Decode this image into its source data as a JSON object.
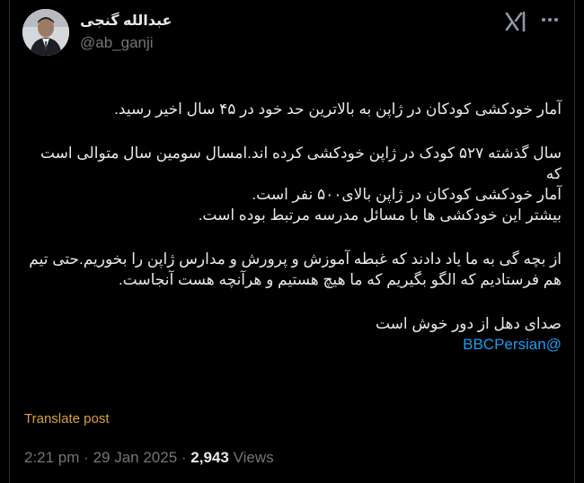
{
  "author": {
    "name": "عبدالله گنجی",
    "handle": "@ab_ganji"
  },
  "icons": {
    "avatar": "avatar",
    "grok": "grok-icon",
    "more": "more-icon"
  },
  "post": {
    "p1": "آمار خودکشی کودکان در ژاپن به بالاترین حد خود در ۴۵ سال اخیر رسید.",
    "p2a": "سال گذشته ۵۲۷ کودک در ژاپن خودکشی کرده اند.امسال سومین سال متوالی است که",
    "p2b": "آمار خودکشی کودکان در ژاپن بالای۵۰۰ نفر است.",
    "p2c": "بیشتر این خودکشی ها با مسائل مدرسه مرتبط بوده است.",
    "p3a": "از بچه گی به ما یاد دادند که غبطه آموزش و پرورش و مدارس ژاپن را بخوریم.حتی تیم",
    "p3b": "هم فرستادیم که الگو بگیریم که ما هیچ هستیم و هرآنچه هست آنجاست.",
    "p4": "صدای دهل از دور خوش است",
    "mention": "@BBCPersian"
  },
  "translate_label": "Translate post",
  "meta": {
    "time": "2:21 pm",
    "date": "29 Jan 2025",
    "views_count": "2,943",
    "views_label": "Views"
  },
  "colors": {
    "accent": "#1d9bf0",
    "translate": "#d8a13c",
    "muted": "#71767b"
  }
}
